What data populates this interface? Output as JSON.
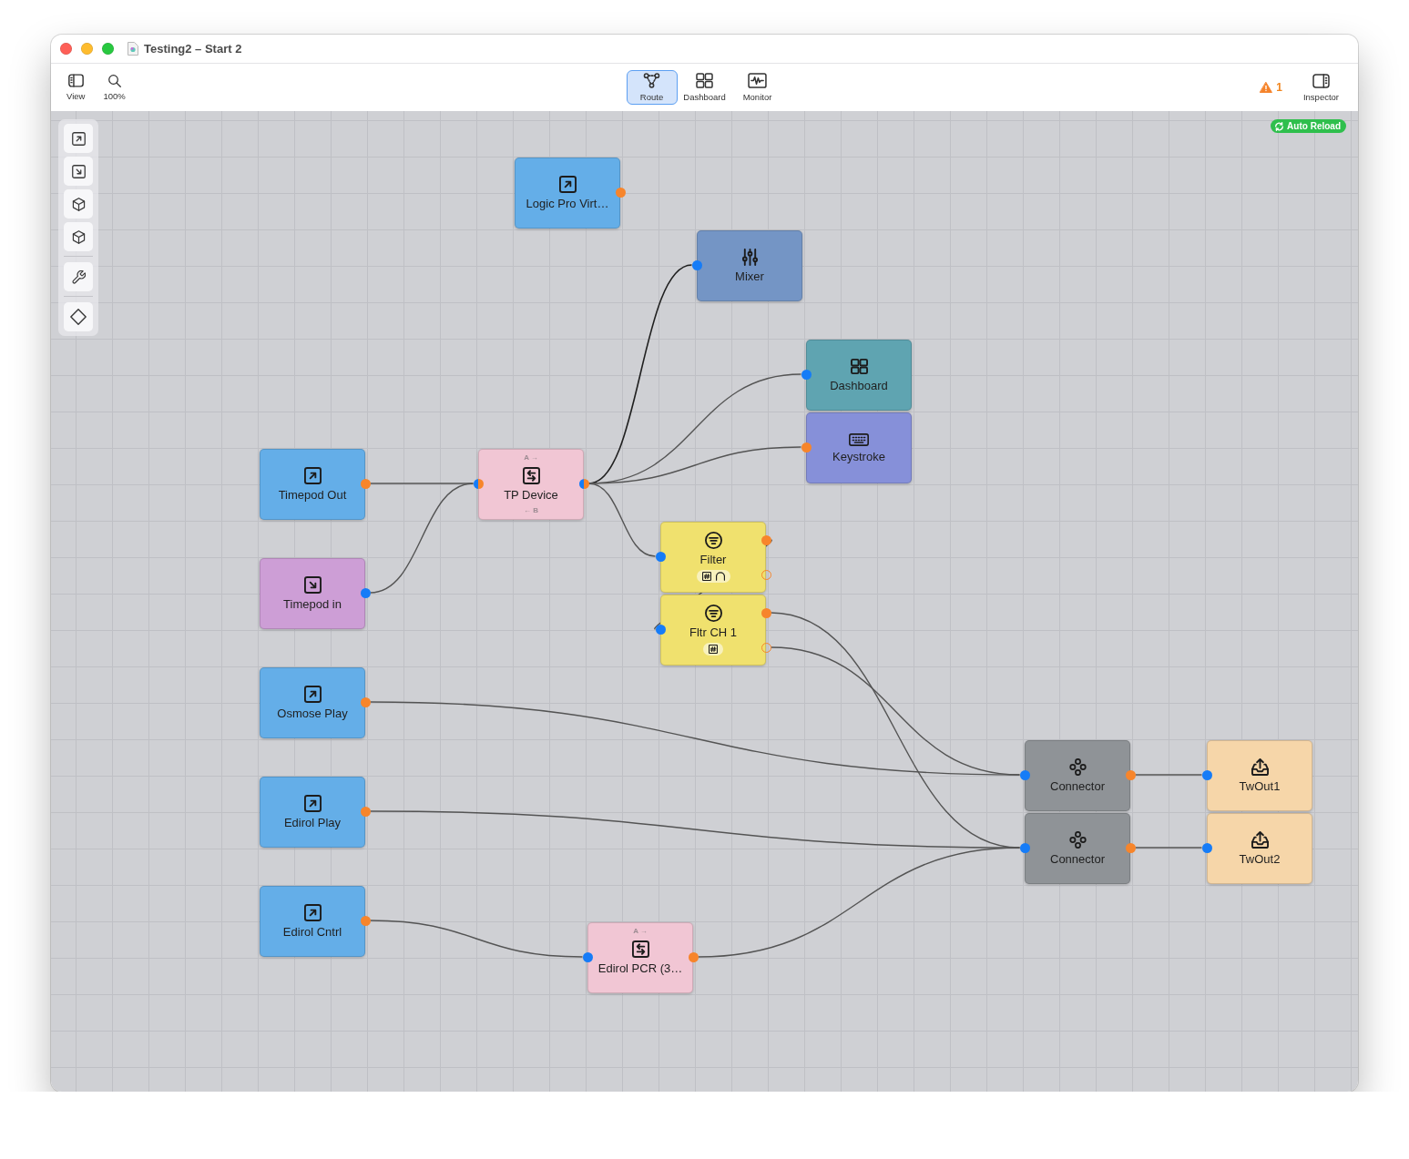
{
  "window": {
    "title": "Testing2 – Start 2"
  },
  "toolbar": {
    "left": [
      {
        "kind": "sidebar",
        "label": "View"
      },
      {
        "kind": "zoom",
        "label": "100%"
      }
    ],
    "modes": [
      {
        "kind": "route",
        "label": "Route",
        "selected": true
      },
      {
        "kind": "dashboard",
        "label": "Dashboard",
        "selected": false
      },
      {
        "kind": "monitor",
        "label": "Monitor",
        "selected": false
      }
    ],
    "warnings": "1",
    "right": [
      {
        "kind": "inspector",
        "label": "Inspector"
      }
    ]
  },
  "canvas": {
    "auto_reload": "Auto Reload",
    "palette": [
      {
        "tools": [
          {
            "kind": "output"
          },
          {
            "kind": "input"
          },
          {
            "kind": "module"
          },
          {
            "kind": "module"
          }
        ]
      },
      {
        "tools": [
          {
            "kind": "wrench"
          }
        ]
      },
      {
        "tools": [
          {
            "kind": "diamond"
          }
        ]
      }
    ],
    "nodes": [
      {
        "label": "Logic Pro Virt…",
        "kind": "output",
        "color": "#64aee8"
      },
      {
        "label": "Mixer",
        "kind": "mixer",
        "color": "#7495c5"
      },
      {
        "label": "Dashboard",
        "kind": "dashboard",
        "color": "#5fa4b1"
      },
      {
        "label": "Keystroke",
        "kind": "keystroke",
        "color": "#8690d9"
      },
      {
        "label": "Timepod Out",
        "kind": "output",
        "color": "#64aee8"
      },
      {
        "label": "TP Device",
        "kind": "device",
        "color": "#f1c6d4",
        "top_label": "A →",
        "bottom_label": "← B"
      },
      {
        "label": "Filter",
        "kind": "filter",
        "color": "#f0e16e",
        "badges": [
          {
            "kind": "hash"
          },
          {
            "kind": "arc"
          }
        ]
      },
      {
        "label": "Timepod in",
        "kind": "input",
        "color": "#cd9ed6"
      },
      {
        "label": "Fltr CH 1",
        "kind": "filter",
        "color": "#f0e16e",
        "badges": [
          {
            "kind": "hash"
          }
        ]
      },
      {
        "label": "Osmose Play",
        "kind": "output",
        "color": "#64aee8"
      },
      {
        "label": "Connector",
        "kind": "connector",
        "color": "#8f9397"
      },
      {
        "label": "TwOut1",
        "kind": "destination",
        "color": "#f6d6a9"
      },
      {
        "label": "Edirol Play",
        "kind": "output",
        "color": "#64aee8"
      },
      {
        "label": "Connector",
        "kind": "connector",
        "color": "#8f9397"
      },
      {
        "label": "TwOut2",
        "kind": "destination",
        "color": "#f6d6a9"
      },
      {
        "label": "Edirol Cntrl",
        "kind": "output",
        "color": "#64aee8"
      },
      {
        "label": "Edirol PCR (3…",
        "kind": "device",
        "color": "#f1c6d4",
        "top_label": "A →"
      }
    ]
  }
}
